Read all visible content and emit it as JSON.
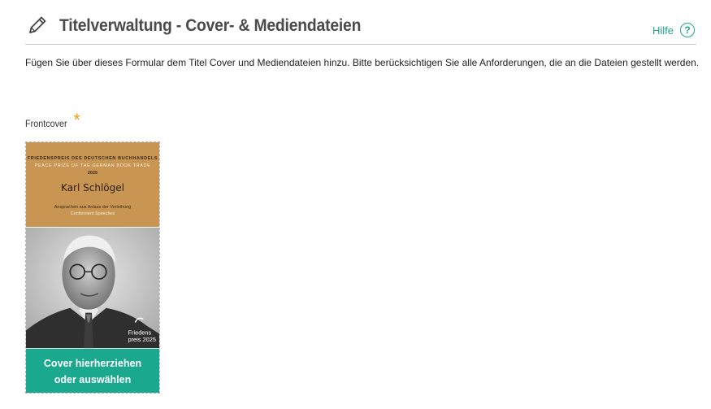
{
  "header": {
    "title": "Titelverwaltung - Cover- & Mediendateien",
    "help_label": "Hilfe",
    "help_icon_glyph": "?"
  },
  "intro": "Fügen Sie über dieses Formular dem Titel Cover und Mediendateien hinzu. Bitte berücksichtigen Sie alle Anforderungen, die an die Dateien gestellt werden.",
  "frontcover": {
    "label": "Frontcover",
    "required_mark": "*",
    "cover": {
      "line1": "FRIEDENSPREIS DES DEUTSCHEN BUCHHANDELS",
      "line2": "PEACE PRIZE OF THE GERMAN BOOK TRADE",
      "year": "2025",
      "author": "Karl Schlögel",
      "subtitle1": "Ansprachen aus Anlass der Verleihung",
      "subtitle2": "Conferment Speeches",
      "logo_line1": "Friedens",
      "logo_line2": "preis 2025"
    },
    "cta_label": "Cover hierherziehen oder auswählen"
  },
  "colors": {
    "accent": "#1aa88e",
    "required": "#f0a020",
    "cover_band": "#c89552"
  }
}
